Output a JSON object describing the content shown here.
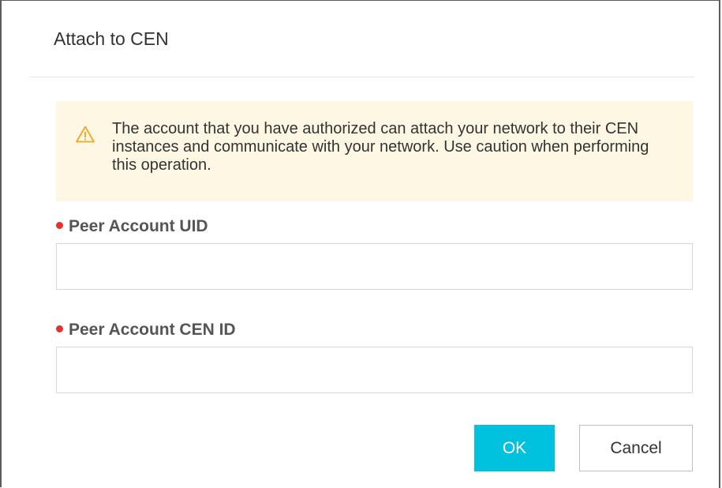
{
  "dialog": {
    "title": "Attach to CEN"
  },
  "alert": {
    "icon": "warning-triangle-icon",
    "message": "The account that you have authorized can attach your network to their CEN instances and communicate with your network. Use caution when performing this operation.",
    "background_color": "#fdf7e4",
    "icon_color": "#f5a623"
  },
  "form": {
    "peer_uid": {
      "label": "Peer Account UID",
      "value": "",
      "placeholder": "",
      "required": true
    },
    "peer_cen_id": {
      "label": "Peer Account CEN ID",
      "value": "",
      "placeholder": "",
      "required": true
    }
  },
  "buttons": {
    "ok_label": "OK",
    "cancel_label": "Cancel",
    "primary_color": "#00c1de"
  },
  "required_marker_color": "#e8302d"
}
